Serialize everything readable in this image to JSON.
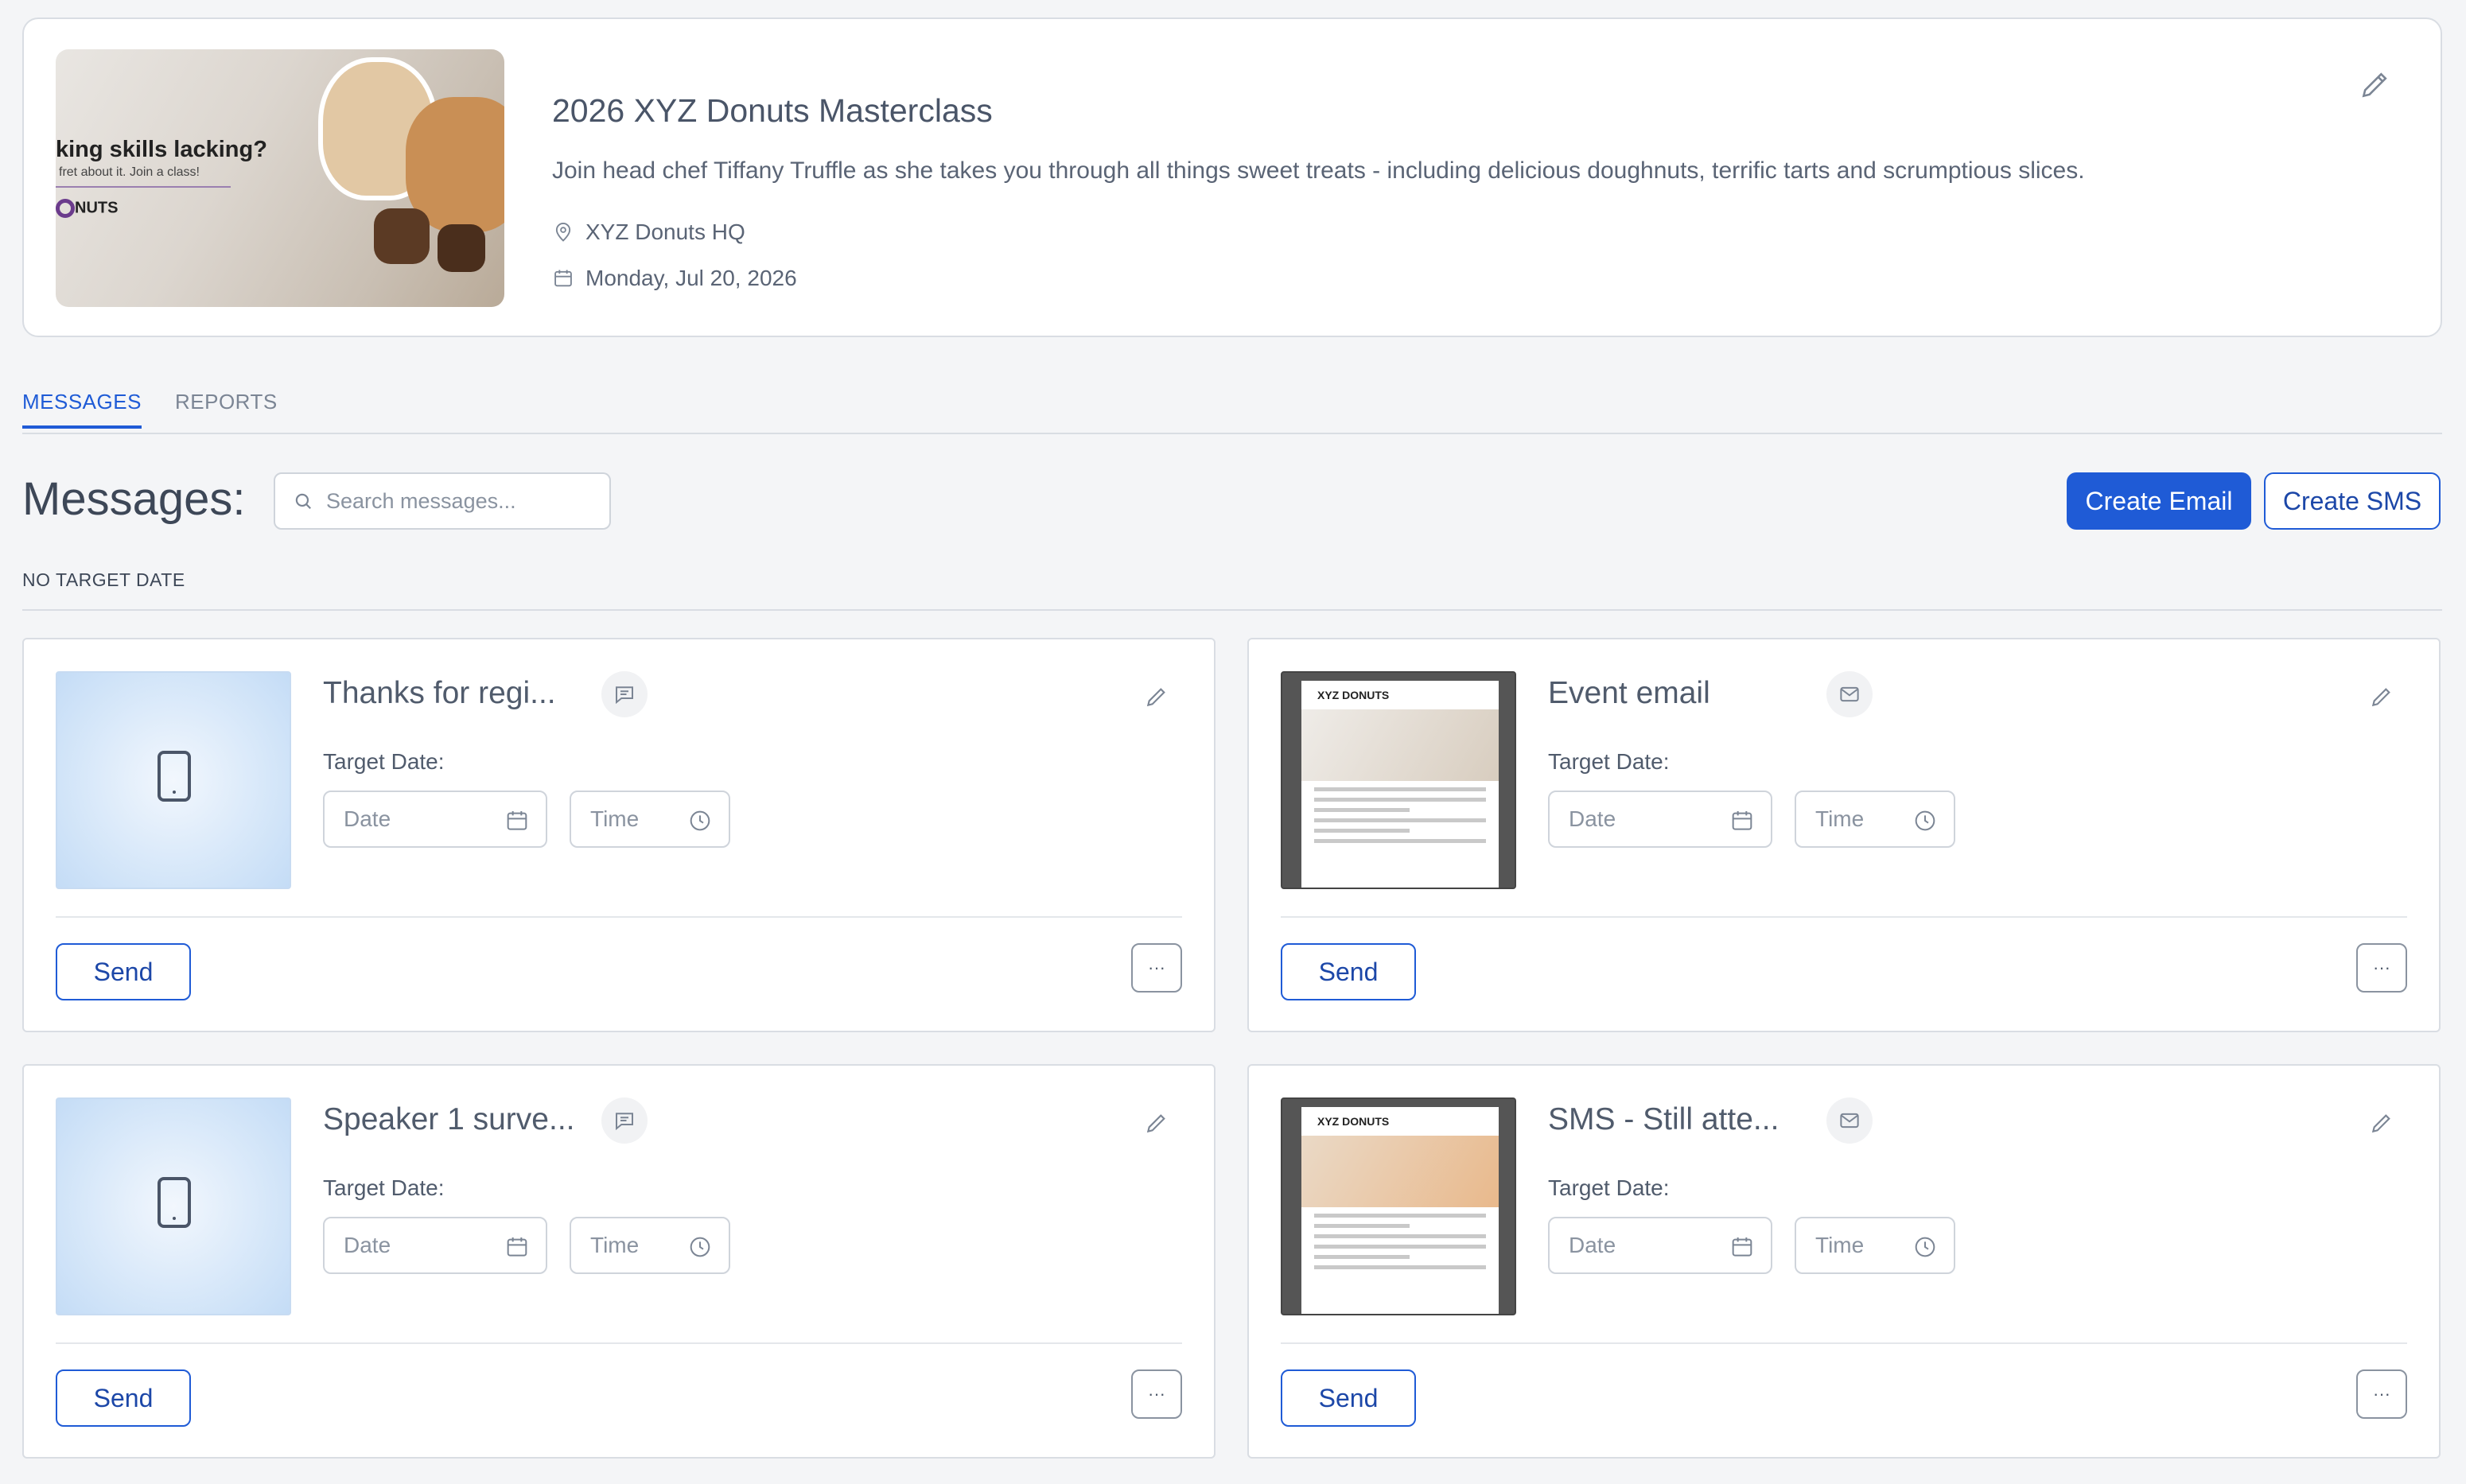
{
  "event": {
    "thumb_headline": "king skills lacking?",
    "thumb_subline": "fret about it. Join a class!",
    "thumb_logo": "NUTS",
    "title": "2026 XYZ Donuts Masterclass",
    "description": "Join head chef Tiffany Truffle as she takes you through all things sweet treats - including delicious doughnuts, terrific tarts and scrumptious slices.",
    "location": "XYZ Donuts HQ",
    "date": "Monday, Jul 20, 2026"
  },
  "tabs": [
    {
      "label": "MESSAGES",
      "active": true
    },
    {
      "label": "REPORTS",
      "active": false
    }
  ],
  "toolbar": {
    "heading": "Messages:",
    "search_placeholder": "Search messages...",
    "create_email": "Create Email",
    "create_sms": "Create SMS"
  },
  "section": {
    "label": "NO TARGET DATE"
  },
  "messages": [
    {
      "title": "Thanks for regi...",
      "type": "sms",
      "type_icon": "chat-icon",
      "target_label": "Target Date:",
      "date_placeholder": "Date",
      "time_placeholder": "Time",
      "send": "Send",
      "more": "···"
    },
    {
      "title": "Event email",
      "type": "email",
      "type_icon": "mail-icon",
      "thumb_logo": "XYZ DONUTS",
      "target_label": "Target Date:",
      "date_placeholder": "Date",
      "time_placeholder": "Time",
      "send": "Send",
      "more": "···"
    },
    {
      "title": "Speaker 1 surve...",
      "type": "sms",
      "type_icon": "chat-icon",
      "target_label": "Target Date:",
      "date_placeholder": "Date",
      "time_placeholder": "Time",
      "send": "Send",
      "more": "···"
    },
    {
      "title": "SMS - Still atte...",
      "type": "email",
      "type_icon": "mail-icon",
      "thumb_logo": "XYZ DONUTS",
      "target_label": "Target Date:",
      "date_placeholder": "Date",
      "time_placeholder": "Time",
      "send": "Send",
      "more": "···"
    }
  ],
  "colors": {
    "accent": "#1f5bd6",
    "border": "#d9dde3",
    "background": "#f4f5f7"
  }
}
